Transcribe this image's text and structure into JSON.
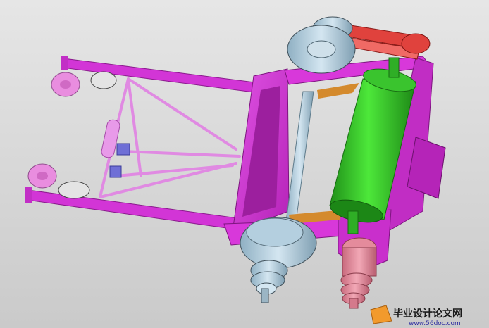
{
  "watermark": {
    "title": "毕业设计论文网",
    "url": "www.56doc.com"
  },
  "colors": {
    "frame": "#d235d6",
    "frame_dark": "#9c1f9e",
    "drum": "#36d12a",
    "drum_dark": "#1f8f18",
    "pulley": "#b9d2e2",
    "pulley_dark": "#6f8fa3",
    "belt": "#e0423d",
    "shaft": "#c8dde9",
    "pink_shaft": "#e48b9c",
    "background_top": "#e6e6e6",
    "background_bottom": "#c9c9c9"
  }
}
